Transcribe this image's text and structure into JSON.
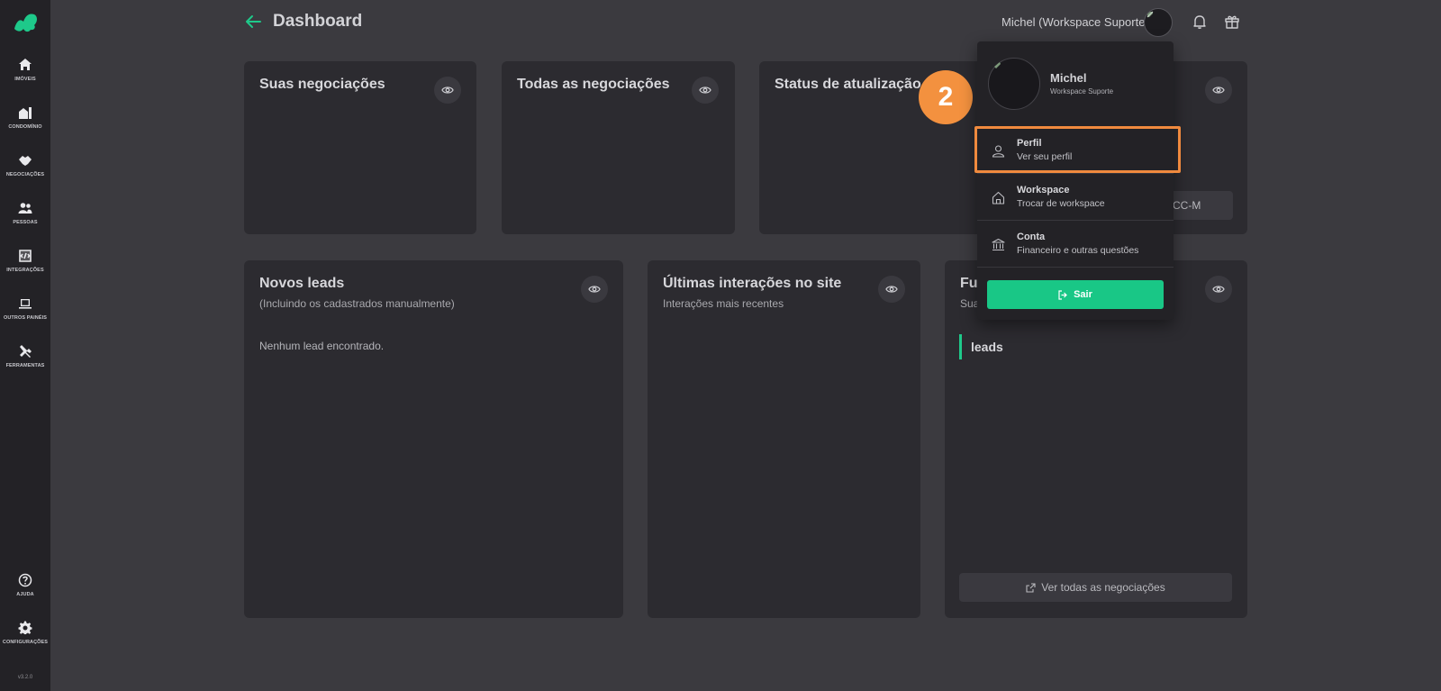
{
  "sidebar": {
    "items": [
      {
        "label": "IMÓVEIS",
        "icon": "home-icon"
      },
      {
        "label": "CONDOMÍNIO",
        "icon": "building-icon"
      },
      {
        "label": "NEGOCIAÇÕES",
        "icon": "handshake-icon"
      },
      {
        "label": "PESSOAS",
        "icon": "users-icon"
      },
      {
        "label": "INTEGRAÇÕES",
        "icon": "integration-icon"
      },
      {
        "label": "OUTROS PAINÉIS",
        "icon": "laptop-icon"
      },
      {
        "label": "FERRAMENTAS",
        "icon": "tools-icon"
      }
    ],
    "bottom": [
      {
        "label": "AJUDA",
        "icon": "help-icon"
      },
      {
        "label": "CONFIGURAÇÕES",
        "icon": "gear-icon"
      }
    ],
    "version": "v3.2.0"
  },
  "header": {
    "title": "Dashboard",
    "user": "Michel (Workspace Suporte)"
  },
  "cards": {
    "suas_negociacoes": {
      "title": "Suas negociações"
    },
    "todas_negociacoes": {
      "title": "Todas as negociações"
    },
    "status": {
      "title": "Status de atualização",
      "button_partial": "CC-M"
    },
    "novos_leads": {
      "title": "Novos leads",
      "subtitle": "(Incluindo os cadastrados manualmente)",
      "empty": "Nenhum lead encontrado."
    },
    "ultimas_interacoes": {
      "title": "Últimas interações no site",
      "subtitle": "Interações mais recentes"
    },
    "funil": {
      "title_partial": "Fu",
      "subtitle_partial": "Sua",
      "leads_label": "leads",
      "footer_button": "Ver todas as negociações"
    }
  },
  "dropdown": {
    "name": "Michel",
    "workspace": "Workspace Suporte",
    "items": [
      {
        "title": "Perfil",
        "subtitle": "Ver seu perfil",
        "icon": "user-icon"
      },
      {
        "title": "Workspace",
        "subtitle": "Trocar de workspace",
        "icon": "house-icon"
      },
      {
        "title": "Conta",
        "subtitle": "Financeiro e outras questões",
        "icon": "bank-icon"
      }
    ],
    "logout": "Sair"
  },
  "annotation": {
    "step": "2",
    "color": "#f3913f"
  },
  "colors": {
    "accent": "#19c786",
    "highlight": "#f08a3e"
  }
}
